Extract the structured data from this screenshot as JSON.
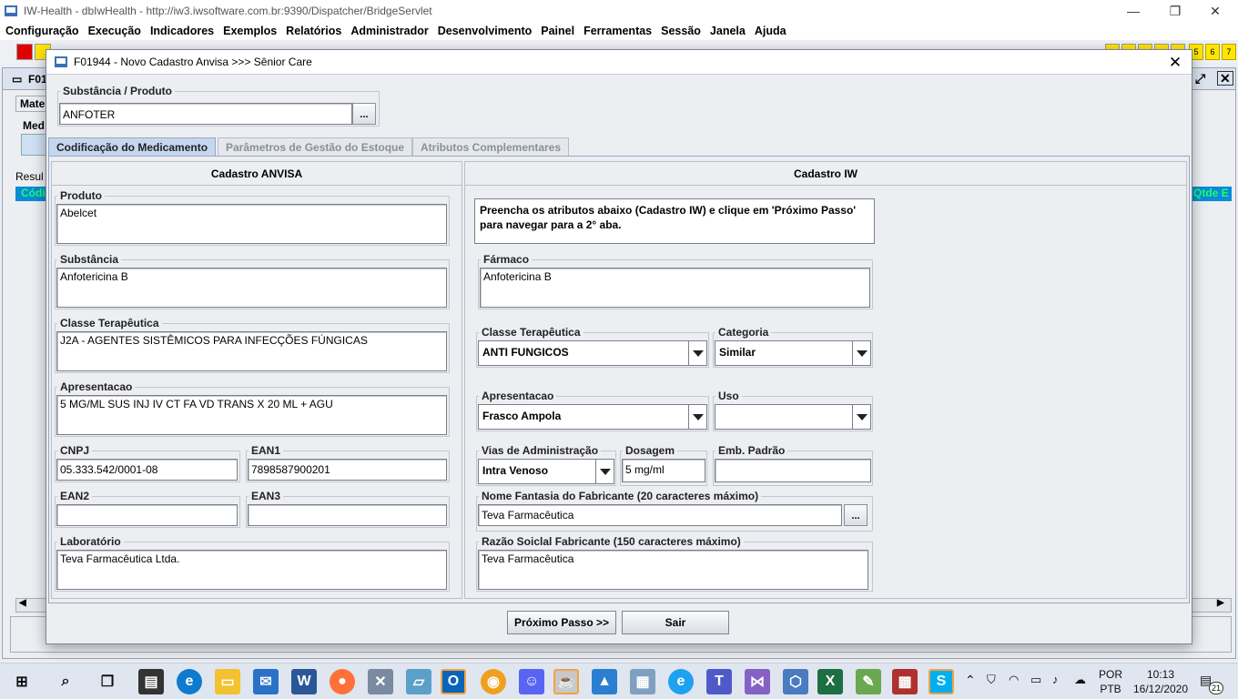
{
  "window": {
    "title": "IW-Health - dbIwHealth - http://iw3.iwsoftware.com.br:9390/Dispatcher/BridgeServlet",
    "minimize": "—",
    "maximize": "❐",
    "close": "✕"
  },
  "menu": [
    "Configuração",
    "Execução",
    "Indicadores",
    "Exemplos",
    "Relatórios",
    "Administrador",
    "Desenvolvimento",
    "Painel",
    "Ferramentas",
    "Sessão",
    "Janela",
    "Ajuda"
  ],
  "toolbar": {
    "numbers": [
      "5",
      "6",
      "7"
    ]
  },
  "background_window": {
    "title_fragment": "F01",
    "tab_fragment": "Mater",
    "group_fragment": "Med",
    "result_fragment": "Resul",
    "col_left": "Códig",
    "col_right": "Qtde E"
  },
  "dialog": {
    "title": "F01944 - Novo Cadastro Anvisa >>> Sênior Care",
    "close": "✕",
    "substancia_legend": "Substância / Produto",
    "substancia_value": "ANFOTER",
    "ellipsis": "...",
    "tabs": [
      "Codificação do Medicamento",
      "Parâmetros de Gestão do Estoque",
      "Atributos Complementares"
    ],
    "anvisa": {
      "header": "Cadastro ANVISA",
      "produto_label": "Produto",
      "produto": "Abelcet",
      "substancia_label": "Substância",
      "substancia": "Anfotericina B",
      "classe_label": "Classe Terapêutica",
      "classe": "J2A - AGENTES SISTÊMICOS PARA INFECÇÕES FÚNGICAS",
      "apresentacao_label": "Apresentacao",
      "apresentacao": "5 MG/ML SUS INJ IV CT FA VD TRANS X 20 ML + AGU",
      "cnpj_label": "CNPJ",
      "cnpj": "05.333.542/0001-08",
      "ean1_label": "EAN1",
      "ean1": "7898587900201",
      "ean2_label": "EAN2",
      "ean2": "",
      "ean3_label": "EAN3",
      "ean3": "",
      "laboratorio_label": "Laboratório",
      "laboratorio": "Teva Farmacêutica Ltda."
    },
    "iw": {
      "header": "Cadastro IW",
      "note_line1": "Preencha os atributos abaixo (Cadastro IW) e clique em 'Próximo Passo'",
      "note_line2": "para navegar para a 2° aba.",
      "farmaco_label": "Fármaco",
      "farmaco": "Anfotericina B",
      "classe_label": "Classe Terapêutica",
      "classe": "ANTI FUNGICOS",
      "categoria_label": "Categoria",
      "categoria": "Similar",
      "apresentacao_label": "Apresentacao",
      "apresentacao": "Frasco Ampola",
      "uso_label": "Uso",
      "uso": "",
      "vias_label": "Vias de Administração",
      "vias": "Intra Venoso",
      "dosagem_label": "Dosagem",
      "dosagem": "5 mg/ml",
      "emb_label": "Emb. Padrão",
      "emb": "",
      "fantasia_label": "Nome Fantasia do Fabricante (20 caracteres máximo)",
      "fantasia": "Teva Farmacêutica",
      "razao_label": "Razão Soiclal Fabricante (150 caracteres máximo)",
      "razao": "Teva Farmacêutica"
    },
    "buttons": {
      "next": "Próximo Passo >>",
      "exit": "Sair"
    }
  },
  "taskbar": {
    "lang1": "POR",
    "lang2": "PTB",
    "time": "10:13",
    "date": "16/12/2020",
    "notif_count": "21"
  }
}
